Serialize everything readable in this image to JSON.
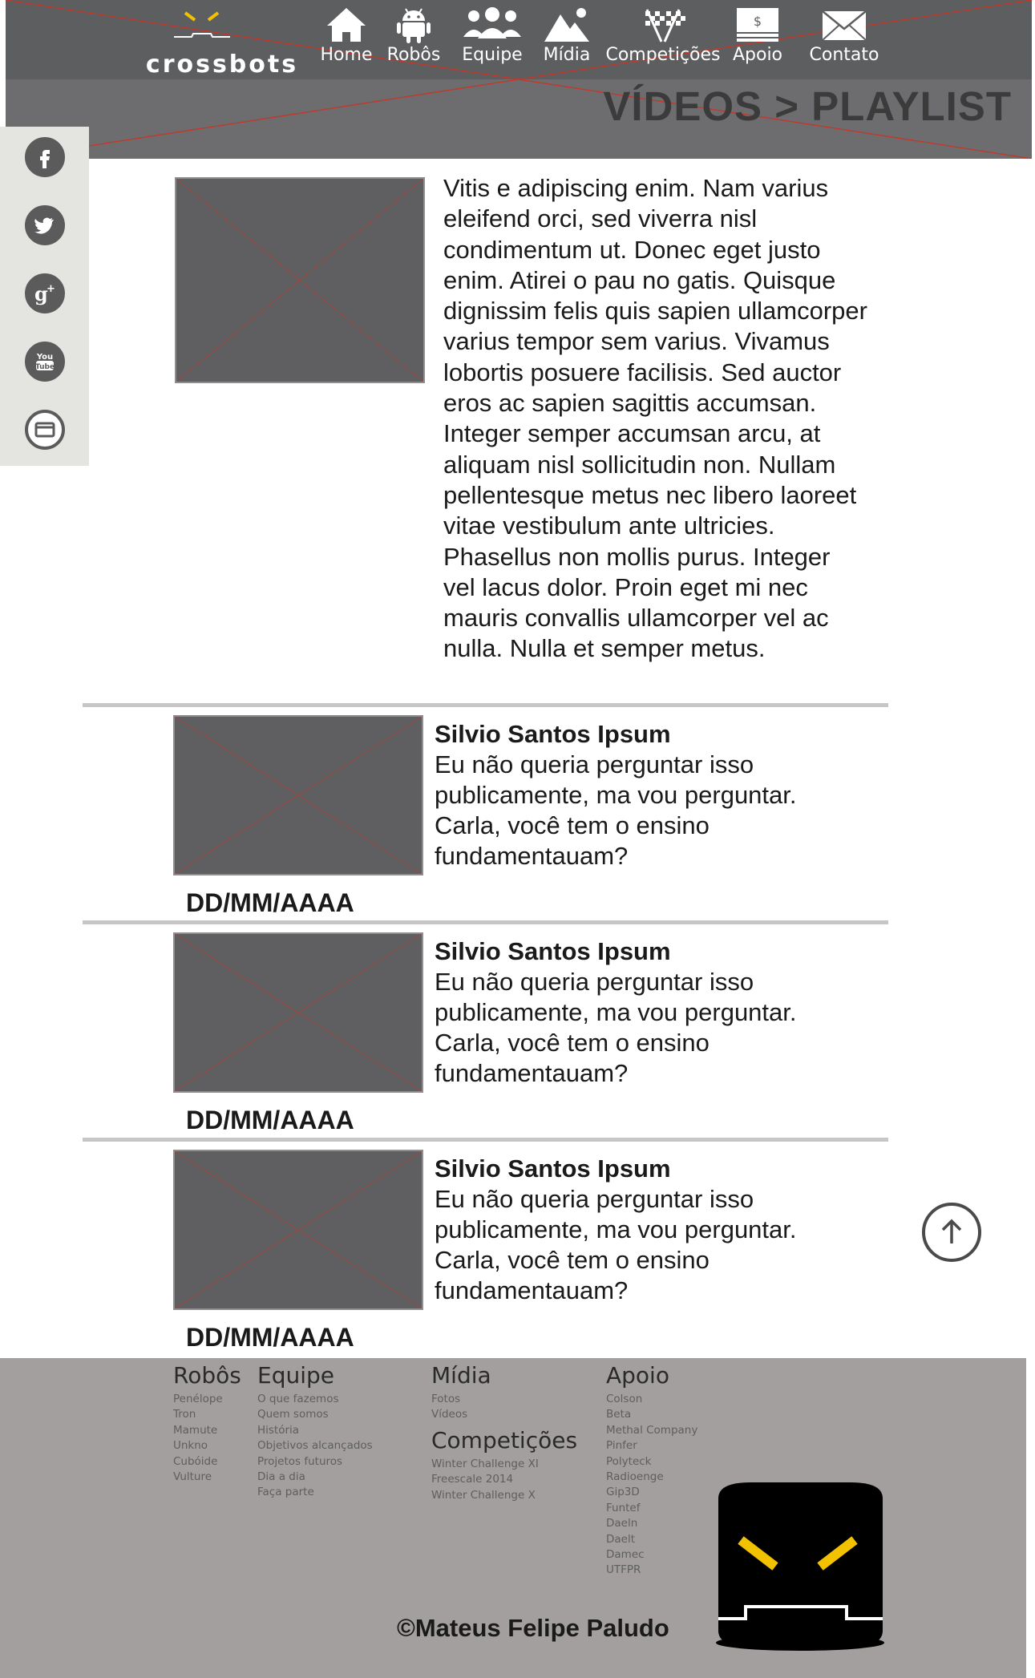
{
  "brand": {
    "name": "crossbots"
  },
  "nav": {
    "items": [
      {
        "label": "Home",
        "icon": "home-icon"
      },
      {
        "label": "Robôs",
        "icon": "android-icon"
      },
      {
        "label": "Equipe",
        "icon": "team-icon"
      },
      {
        "label": "Mídia",
        "icon": "mountain-image-icon"
      },
      {
        "label": "Competições",
        "icon": "checkered-flag-icon"
      },
      {
        "label": "Apoio",
        "icon": "money-icon"
      },
      {
        "label": "Contato",
        "icon": "envelope-icon"
      }
    ]
  },
  "page": {
    "title": "VÍDEOS > PLAYLIST"
  },
  "social": {
    "items": [
      {
        "icon": "facebook-icon"
      },
      {
        "icon": "twitter-icon"
      },
      {
        "icon": "google-plus-icon"
      },
      {
        "icon": "youtube-icon",
        "text": "You Tube"
      },
      {
        "icon": "email-icon"
      }
    ]
  },
  "main_video": {
    "description": "Vitis e adipiscing enim. Nam varius eleifend orci, sed viverra nisl condimentum ut. Donec eget justo enim. Atirei o pau no gatis. Quisque dignissim felis quis sapien ullamcorper varius tempor sem varius. Vivamus lobortis posuere facilisis. Sed auctor eros ac sapien sagittis accumsan. Integer semper accumsan arcu, at aliquam nisl sollicitudin non. Nullam pellentesque metus nec libero laoreet vitae vestibulum ante ultricies. Phasellus non mollis purus. Integer vel lacus dolor. Proin eget mi nec mauris convallis ullamcorper vel ac nulla. Nulla et semper metus."
  },
  "playlist": [
    {
      "title": "Silvio Santos Ipsum",
      "description": "Eu não queria perguntar isso publicamente, ma vou perguntar. Carla, você tem o ensino fundamentauam?",
      "date": "DD/MM/AAAA"
    },
    {
      "title": "Silvio Santos Ipsum",
      "description": "Eu não queria perguntar isso publicamente, ma vou perguntar. Carla, você tem o ensino fundamentauam?",
      "date": "DD/MM/AAAA"
    },
    {
      "title": "Silvio Santos Ipsum",
      "description": "Eu não queria perguntar isso publicamente, ma vou perguntar. Carla, você tem o ensino fundamentauam?",
      "date": "DD/MM/AAAA"
    }
  ],
  "scroll_top": {
    "icon": "arrow-up-icon"
  },
  "footer": {
    "robos": {
      "heading": "Robôs",
      "links": [
        "Penélope",
        "Tron",
        "Mamute",
        "Unkno",
        "Cubóide",
        "Vulture"
      ]
    },
    "equipe": {
      "heading": "Equipe",
      "links": [
        "O que fazemos",
        "Quem somos",
        "História",
        "Objetivos alcançados",
        "Projetos futuros",
        "Dia a dia",
        "Faça parte"
      ]
    },
    "midia": {
      "heading": "Mídia",
      "links": [
        "Fotos",
        "Vídeos"
      ]
    },
    "competicoes": {
      "heading": "Competições",
      "links": [
        "Winter Challenge XI",
        "Freescale 2014",
        "Winter Challenge X"
      ]
    },
    "apoio": {
      "heading": "Apoio",
      "links": [
        "Colson",
        "Beta",
        "Methal Company",
        "Pinfer",
        "Polyteck",
        "Radioenge",
        "Gip3D",
        "Funtef",
        "Daeln",
        "Daelt",
        "Damec",
        "UTFPR"
      ]
    },
    "copyright": "©Mateus Felipe Paludo"
  },
  "colors": {
    "header": "#5d5e60",
    "header_lower": "#6d6d6f",
    "footer": "#a39f9f",
    "accent_yellow": "#f2c200",
    "placeholder_line": "#c0392b"
  }
}
